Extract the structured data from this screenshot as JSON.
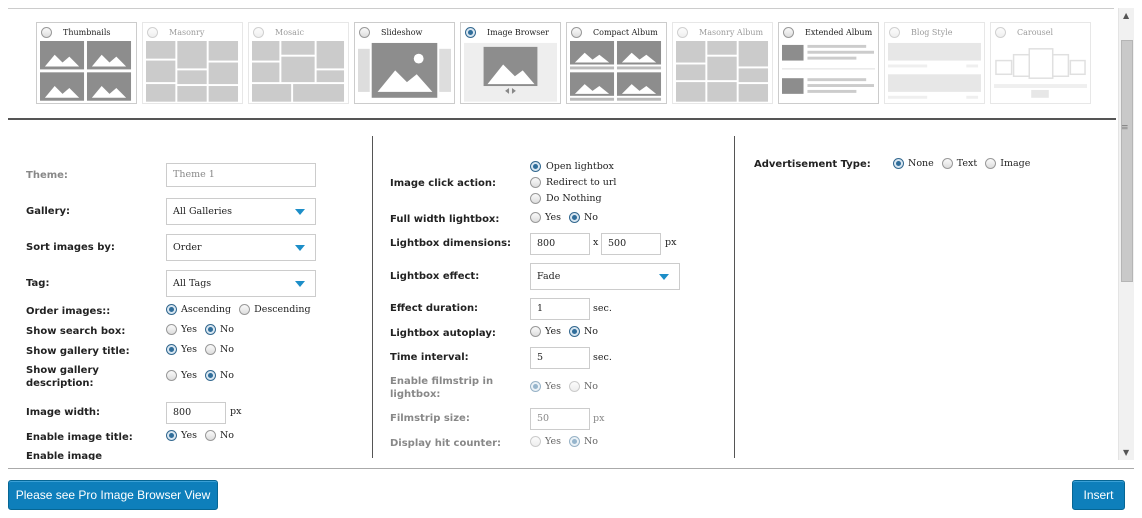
{
  "views": [
    {
      "label": "Thumbnails",
      "selected": false,
      "disabled": false,
      "icon": "thumbnails-grid-icon"
    },
    {
      "label": "Masonry",
      "selected": false,
      "disabled": true,
      "icon": "masonry-icon"
    },
    {
      "label": "Mosaic",
      "selected": false,
      "disabled": true,
      "icon": "mosaic-icon"
    },
    {
      "label": "Slideshow",
      "selected": false,
      "disabled": false,
      "icon": "slideshow-icon"
    },
    {
      "label": "Image Browser",
      "selected": true,
      "disabled": false,
      "icon": "image-browser-icon"
    },
    {
      "label": "Compact Album",
      "selected": false,
      "disabled": false,
      "icon": "compact-album-icon"
    },
    {
      "label": "Masonry Album",
      "selected": false,
      "disabled": true,
      "icon": "masonry-album-icon"
    },
    {
      "label": "Extended Album",
      "selected": false,
      "disabled": false,
      "icon": "extended-album-icon"
    },
    {
      "label": "Blog Style",
      "selected": false,
      "disabled": true,
      "icon": "blog-style-icon"
    },
    {
      "label": "Carousel",
      "selected": false,
      "disabled": true,
      "icon": "carousel-icon"
    }
  ],
  "left": {
    "theme_label": "Theme:",
    "theme_value": "Theme 1",
    "gallery_label": "Gallery:",
    "gallery_value": "All Galleries",
    "sort_label": "Sort images by:",
    "sort_value": "Order",
    "tag_label": "Tag:",
    "tag_value": "All Tags",
    "order_label": "Order images::",
    "order_asc": "Ascending",
    "order_desc": "Descending",
    "search_label": "Show search box:",
    "title_label": "Show gallery title:",
    "desc_label": "Show gallery description:",
    "width_label": "Image width:",
    "width_value": "800",
    "width_unit": "px",
    "img_title_label": "Enable image title:",
    "enable_image_label": "Enable image"
  },
  "middle": {
    "click_label": "Image click action:",
    "click_opt1": "Open lightbox",
    "click_opt2": "Redirect to url",
    "click_opt3": "Do Nothing",
    "fullwidth_label": "Full width lightbox:",
    "dim_label": "Lightbox dimensions:",
    "dim_w": "800",
    "dim_x": "x",
    "dim_h": "500",
    "dim_unit": "px",
    "effect_label": "Lightbox effect:",
    "effect_value": "Fade",
    "duration_label": "Effect duration:",
    "duration_value": "1",
    "duration_unit": "sec.",
    "autoplay_label": "Lightbox autoplay:",
    "interval_label": "Time interval:",
    "interval_value": "5",
    "interval_unit": "sec.",
    "filmstrip_label": "Enable filmstrip in lightbox:",
    "fsize_label": "Filmstrip size:",
    "fsize_value": "50",
    "fsize_unit": "px",
    "hit_label": "Display hit counter:"
  },
  "right": {
    "ad_label": "Advertisement Type:",
    "ad_none": "None",
    "ad_text": "Text",
    "ad_image": "Image"
  },
  "common": {
    "yes": "Yes",
    "no": "No"
  },
  "buttons": {
    "pro": "Please see Pro Image Browser View",
    "insert": "Insert"
  },
  "colors": {
    "accent": "#0e7fbb",
    "radio_selected": "#2f6d9a",
    "select_arrow": "#1d8ec8"
  }
}
